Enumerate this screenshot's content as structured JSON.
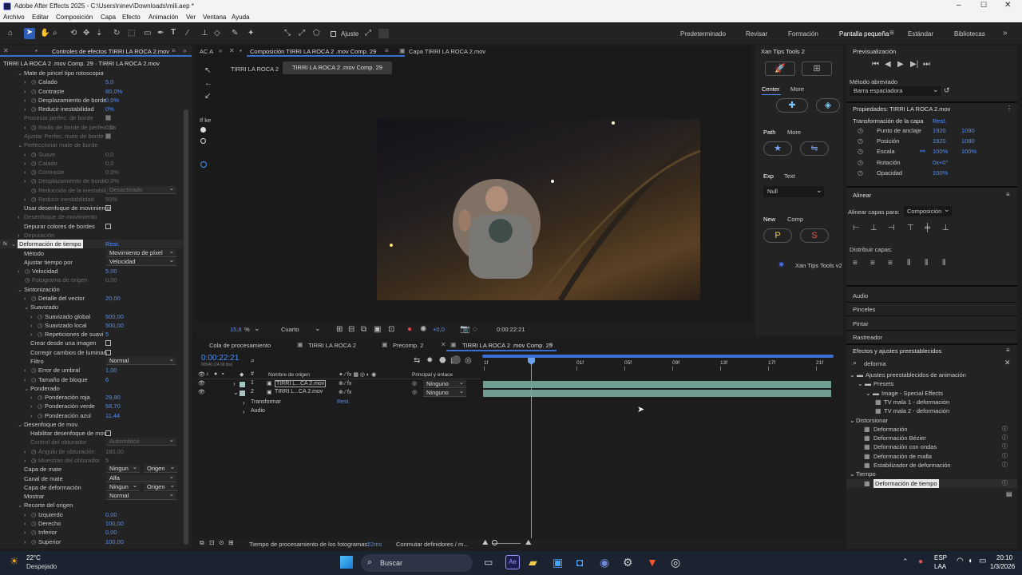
{
  "window": {
    "title": "Adobe After Effects 2025 - C:\\Users\\ninev\\Downloads\\mili.aep *"
  },
  "menu": [
    "Archivo",
    "Editar",
    "Composición",
    "Capa",
    "Efecto",
    "Animación",
    "Ver",
    "Ventana",
    "Ayuda"
  ],
  "toolbar": {
    "ajuste": "Ajuste"
  },
  "workspaces": [
    "Predeterminado",
    "Revisar",
    "Formación",
    "Pantalla pequeña",
    "Estándar",
    "Bibliotecas"
  ],
  "effects_panel": {
    "tab": "Controles de efectos TIRRI LA ROCA 2.mov",
    "header": "TIRRI LA ROCA 2 .mov Comp. 29 · TIRRI LA ROCA 2.mov",
    "rows": [
      {
        "i": 1,
        "label": "Mate de pincel tipo rotoscopia",
        "chev": "v"
      },
      {
        "i": 2,
        "label": "Calado",
        "value": "5,0",
        "chev": ">",
        "sw": true
      },
      {
        "i": 2,
        "label": "Contraste",
        "value": "80,0%",
        "chev": ">",
        "sw": true
      },
      {
        "i": 2,
        "label": "Desplazamiento de borde",
        "value": "0,0%",
        "chev": ">",
        "sw": true
      },
      {
        "i": 2,
        "label": "Reducir inestabilidad",
        "value": "0%",
        "chev": ">",
        "sw": true
      },
      {
        "i": 1,
        "label": "Procesar perfec. de borde",
        "check": "on",
        "dim": true
      },
      {
        "i": 2,
        "label": "Radio de borde de perfec. ba",
        "value": "0,0",
        "chev": ">",
        "sw": true,
        "dim": true
      },
      {
        "i": 1,
        "label": "Ajustar Perfec. mate de borde",
        "check": "on",
        "dim": true
      },
      {
        "i": 1,
        "label": "Perfeccionar mate de borde",
        "chev": "v",
        "dim": true
      },
      {
        "i": 2,
        "label": "Suave",
        "value": "0,0",
        "chev": ">",
        "sw": true,
        "dim": true
      },
      {
        "i": 2,
        "label": "Calado",
        "value": "0,0",
        "chev": ">",
        "sw": true,
        "dim": true
      },
      {
        "i": 2,
        "label": "Contraste",
        "value": "0,0%",
        "chev": ">",
        "sw": true,
        "dim": true
      },
      {
        "i": 2,
        "label": "Desplazamiento de borde",
        "value": "0,0%",
        "chev": ">",
        "sw": true,
        "dim": true
      },
      {
        "i": 2,
        "label": "Reducción de la inestabili",
        "dropdown": "Desactivado",
        "sw": true,
        "dim": true
      },
      {
        "i": 2,
        "label": "Reducir inestabilidad",
        "value": "50%",
        "chev": ">",
        "sw": true,
        "dim": true
      },
      {
        "i": 1,
        "label": "Usar desenfoque de movimiento",
        "check": "off"
      },
      {
        "i": 1,
        "label": "Desenfoque de movimiento",
        "chev": ">",
        "dim": true
      },
      {
        "i": 1,
        "label": "Depurar colores de bordes",
        "check": "off"
      },
      {
        "i": 1,
        "label": "Depuración",
        "chev": ">",
        "dim": true
      },
      {
        "i": 0,
        "label": "Deformación de tiempo",
        "value": "Rest.",
        "chev": "v",
        "fx": true,
        "selected": true
      },
      {
        "i": 1,
        "label": "Método",
        "dropdown": "Movimiento de píxel"
      },
      {
        "i": 1,
        "label": "Ajustar tiempo por",
        "dropdown": "Velocidad"
      },
      {
        "i": 1,
        "label": "Velocidad",
        "value": "5,00",
        "chev": ">",
        "sw": true
      },
      {
        "i": 1,
        "label": "Fotograma de origen",
        "value": "0,00",
        "sw": true,
        "dim": true
      },
      {
        "i": 1,
        "label": "Sintonización",
        "chev": "v"
      },
      {
        "i": 2,
        "label": "Detalle del vector",
        "value": "20,00",
        "chev": ">",
        "sw": true
      },
      {
        "i": 2,
        "label": "Suavizado",
        "chev": "v"
      },
      {
        "i": 3,
        "label": "Suavizado global",
        "value": "500,00",
        "chev": ">",
        "sw": true
      },
      {
        "i": 3,
        "label": "Suavizado local",
        "value": "500,00",
        "chev": ">",
        "sw": true
      },
      {
        "i": 3,
        "label": "Repeticiones de suavi",
        "value": "5",
        "chev": ">",
        "sw": true
      },
      {
        "i": 2,
        "label": "Crear desde una imagen",
        "check": "off"
      },
      {
        "i": 2,
        "label": "Corregir cambios de luminan",
        "check": "off"
      },
      {
        "i": 2,
        "label": "Filtro",
        "dropdown": "Normal"
      },
      {
        "i": 2,
        "label": "Error de umbral",
        "value": "1,00",
        "chev": ">",
        "sw": true
      },
      {
        "i": 2,
        "label": "Tamaño de bloque",
        "value": "6",
        "chev": ">",
        "sw": true
      },
      {
        "i": 2,
        "label": "Ponderado",
        "chev": "v"
      },
      {
        "i": 3,
        "label": "Ponderación roja",
        "value": "29,90",
        "chev": ">",
        "sw": true
      },
      {
        "i": 3,
        "label": "Ponderación verde",
        "value": "58,70",
        "chev": ">",
        "sw": true
      },
      {
        "i": 3,
        "label": "Ponderación azul",
        "value": "11,44",
        "chev": ">",
        "sw": true
      },
      {
        "i": 1,
        "label": "Desenfoque de mov.",
        "chev": "v"
      },
      {
        "i": 2,
        "label": "Habilitar desenfoque de mov",
        "check": "off"
      },
      {
        "i": 2,
        "label": "Control del obturador",
        "dropdown": "Automático",
        "dim": true
      },
      {
        "i": 2,
        "label": "Ángulo de obturación",
        "value": "180,00",
        "chev": ">",
        "sw": true,
        "dim": true
      },
      {
        "i": 2,
        "label": "Muestras del obturador",
        "value": "5",
        "chev": ">",
        "sw": true,
        "dim": true
      },
      {
        "i": 1,
        "label": "Capa de mate",
        "dropdown": "Ningun",
        "dropdown2": "Origen"
      },
      {
        "i": 1,
        "label": "Canal de mate",
        "dropdown": "Alfa"
      },
      {
        "i": 1,
        "label": "Capa de deformación",
        "dropdown": "Ningun",
        "dropdown2": "Origen"
      },
      {
        "i": 1,
        "label": "Mostrar",
        "dropdown": "Normal"
      },
      {
        "i": 1,
        "label": "Recorte del origen",
        "chev": "v"
      },
      {
        "i": 2,
        "label": "Izquierdo",
        "value": "0,00",
        "chev": ">",
        "sw": true
      },
      {
        "i": 2,
        "label": "Derecho",
        "value": "100,00",
        "chev": ">",
        "sw": true
      },
      {
        "i": 2,
        "label": "Inferior",
        "value": "0,00",
        "chev": ">",
        "sw": true
      },
      {
        "i": 2,
        "label": "Superior",
        "value": "100,00",
        "chev": ">",
        "sw": true
      }
    ]
  },
  "comp_panel": {
    "tab_left": "AC A",
    "tab": "Composición TIRRI LA ROCA 2 .mov Comp. 29",
    "tab2": "Capa TIRRI LA ROCA 2.mov",
    "crumbs": [
      "TIRRI LA ROCA 2",
      "TIRRI LA ROCA 2 .mov Comp. 29"
    ],
    "side": "If ke",
    "zoom": "15,8",
    "zoom_unit": "%",
    "resolution": "Cuarto",
    "exposure": "+0,0",
    "timecode": "0:00:22:21"
  },
  "xan": {
    "tab": "Xan Tips Tools 2",
    "center": "Center",
    "more": "More",
    "path": "Path",
    "more2": "More",
    "exp": "Exp",
    "text": "Text",
    "null": "Null",
    "new": "New",
    "comp": "Comp",
    "p": "P",
    "s": "S",
    "label": "Xan Tips Tools v2"
  },
  "preview": {
    "title": "Previsualización",
    "method_label": "Método abreviado",
    "method": "Barra espaciadora"
  },
  "properties": {
    "title": "Propiedades: TIRRI LA ROCA 2.mov",
    "transform": "Transformación de la capa",
    "reset": "Rest.",
    "rows": [
      {
        "label": "Punto de anclaje",
        "v1": "1920",
        "v2": "1080"
      },
      {
        "label": "Posición",
        "v1": "1920",
        "v2": "1080"
      },
      {
        "label": "Escala",
        "v1": "100%",
        "v2": "100%"
      },
      {
        "label": "Rotación",
        "v1": "0x+0°",
        "v2": ""
      },
      {
        "label": "Opacidad",
        "v1": "100%",
        "v2": ""
      }
    ]
  },
  "align": {
    "title": "Alinear",
    "align_to_label": "Alinear capas para:",
    "align_to": "Composición",
    "distribute": "Distribuir capas:"
  },
  "side_panels": [
    "Audio",
    "Pinceles",
    "Pintar",
    "Rastreador"
  ],
  "effects_presets": {
    "title": "Efectos y ajustes preestablecidos",
    "search": "deforma",
    "tree": [
      {
        "i": 0,
        "label": "Ajustes preestablecidos de animación",
        "type": "folder"
      },
      {
        "i": 1,
        "label": "Presets",
        "type": "folder"
      },
      {
        "i": 2,
        "label": "Image - Special Effects",
        "type": "folder"
      },
      {
        "i": 3,
        "label": "TV mala 1 - deformación",
        "type": "preset"
      },
      {
        "i": 3,
        "label": "TV mala 2 - deformación",
        "type": "preset"
      },
      {
        "i": 0,
        "label": "Distorsionar",
        "type": "cat"
      },
      {
        "i": 1,
        "label": "Deformación",
        "type": "fx"
      },
      {
        "i": 1,
        "label": "Deformación Bézier",
        "type": "fx"
      },
      {
        "i": 1,
        "label": "Deformación con ondas",
        "type": "fx"
      },
      {
        "i": 1,
        "label": "Deformación de malla",
        "type": "fx"
      },
      {
        "i": 1,
        "label": "Estabilizador de deformación",
        "type": "fx"
      },
      {
        "i": 0,
        "label": "Tiempo",
        "type": "cat"
      },
      {
        "i": 1,
        "label": "Deformación de tiempo",
        "type": "fx",
        "selected": true
      }
    ]
  },
  "timeline": {
    "tabs": [
      "Cola de procesamiento",
      "TIRRI LA ROCA 2",
      "Precomp. 2",
      "TIRRI LA ROCA 2 .mov Comp. 29"
    ],
    "timecode": "0:00:22:21",
    "fps": "00540 (24.00 fps)",
    "col_name": "Nombre de origen",
    "col_parent": "Principal y enlace",
    "layers": [
      {
        "num": "1",
        "name": "TIRRI L...CA 2.mov",
        "parent": "Ninguno"
      },
      {
        "num": "2",
        "name": "TIRRI L...CA 2.mov",
        "parent": "Ninguno"
      }
    ],
    "sub": [
      {
        "label": "Transformar",
        "value": "Rest."
      },
      {
        "label": "Audio",
        "value": ""
      }
    ],
    "ruler": [
      "1f",
      "01f",
      "05f",
      "09f",
      "13f",
      "17f",
      "21f"
    ],
    "render_label": "Tiempo de procesamiento de los fotogramas:",
    "render_value": "22ms",
    "toggle": "Conmutar definidores / m..."
  },
  "taskbar": {
    "temp": "22°C",
    "weather": "Despejado",
    "search": "Buscar",
    "lang1": "ESP",
    "lang2": "LAA",
    "time": "20:10",
    "date": "1/3/2026"
  },
  "colors": {
    "accent": "#4f8ff7",
    "layer_bar": "#6f9d93",
    "bg": "#1d1d1d",
    "panel": "#232323"
  }
}
